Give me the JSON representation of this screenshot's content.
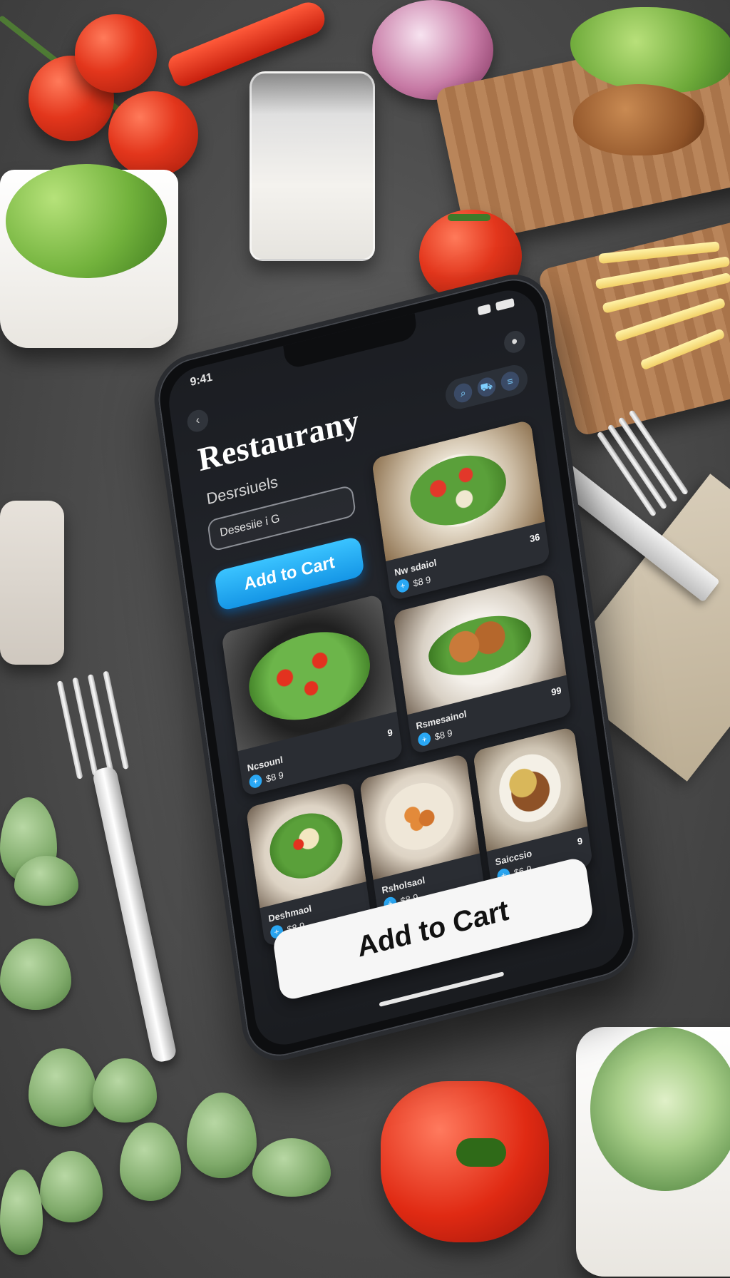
{
  "app": {
    "title": "Restaurany",
    "subtitle": "Desrsiuels",
    "search_text": "Desesiie i G",
    "cta_small_label": "Add to Cart",
    "cta_big_label": "Add to Cart"
  },
  "status_bar": {
    "time": "9:41"
  },
  "menu_items": [
    {
      "name": "Nw sdaiol",
      "price": "$8 9",
      "rating": "36"
    },
    {
      "name": "Rsmesainol",
      "price": "$8 9",
      "rating": "99"
    },
    {
      "name": "Ncsounl",
      "price": "$8 9",
      "rating": "9"
    },
    {
      "name": "Deshmaol",
      "price": "$8 9",
      "rating": ""
    },
    {
      "name": "Saiccsio",
      "price": "$6 9",
      "rating": "9"
    },
    {
      "name": "Rsholsaol",
      "price": "$8 9",
      "rating": ""
    }
  ],
  "colors": {
    "accent": "#1ea6f0",
    "screen_bg": "#1e2126",
    "table_bg": "#555555"
  },
  "icons": {
    "back": "chevron-left-icon",
    "profile": "user-icon",
    "cart": "cart-icon",
    "search": "search-icon"
  }
}
